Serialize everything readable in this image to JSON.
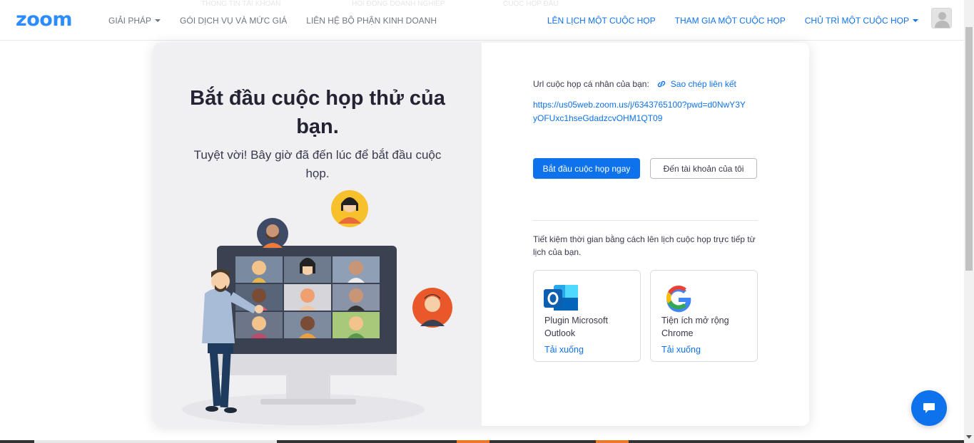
{
  "header": {
    "logo": "zoom",
    "nav_left": [
      "GIẢI PHÁP",
      "GÓI DỊCH VỤ VÀ MỨC GIÁ",
      "LIÊN HỆ BỘ PHẬN KINH DOANH"
    ],
    "nav_right": [
      "LÊN LỊCH MỘT CUỘC HỌP",
      "THAM GIA MỘT CUỘC HỌP",
      "CHỦ TRÌ MỘT CUỘC HỌP"
    ],
    "ghost_left": "THÔNG TIN TÀI KHOẢN",
    "ghost_mid": "HỘI ĐỒNG DOANH NGHIỆP",
    "ghost_right": "CUỘC HỌP ĐẦU"
  },
  "hero": {
    "title": "Bắt đầu cuộc họp thử của bạn.",
    "subtitle": "Tuyệt vời! Bây giờ đã đến lúc để bắt đầu cuộc họp."
  },
  "meeting": {
    "url_label": "Url cuộc họp cá nhân của bạn:",
    "copy_label": "Sao chép liên kết",
    "url": "https://us05web.zoom.us/j/6343765100?pwd=d0NwY3YyOFUxc1hseGdadzcvOHM1QT09",
    "start_button": "Bắt đầu cuộc họp ngay",
    "account_button": "Đến tài khoản của tôi",
    "save_text": "Tiết kiệm thời gian bằng cách lên lịch cuộc họp trực tiếp từ lịch của bạn."
  },
  "plugins": [
    {
      "name": "Plugin Microsoft Outlook",
      "download": "Tải xuống",
      "icon": "outlook-icon"
    },
    {
      "name": "Tiện ích mở rộng Chrome",
      "download": "Tải xuống",
      "icon": "google-icon"
    }
  ],
  "colors": {
    "accent": "#0e72ed",
    "logo": "#2d8cff",
    "panel": "#f0f0f3"
  }
}
